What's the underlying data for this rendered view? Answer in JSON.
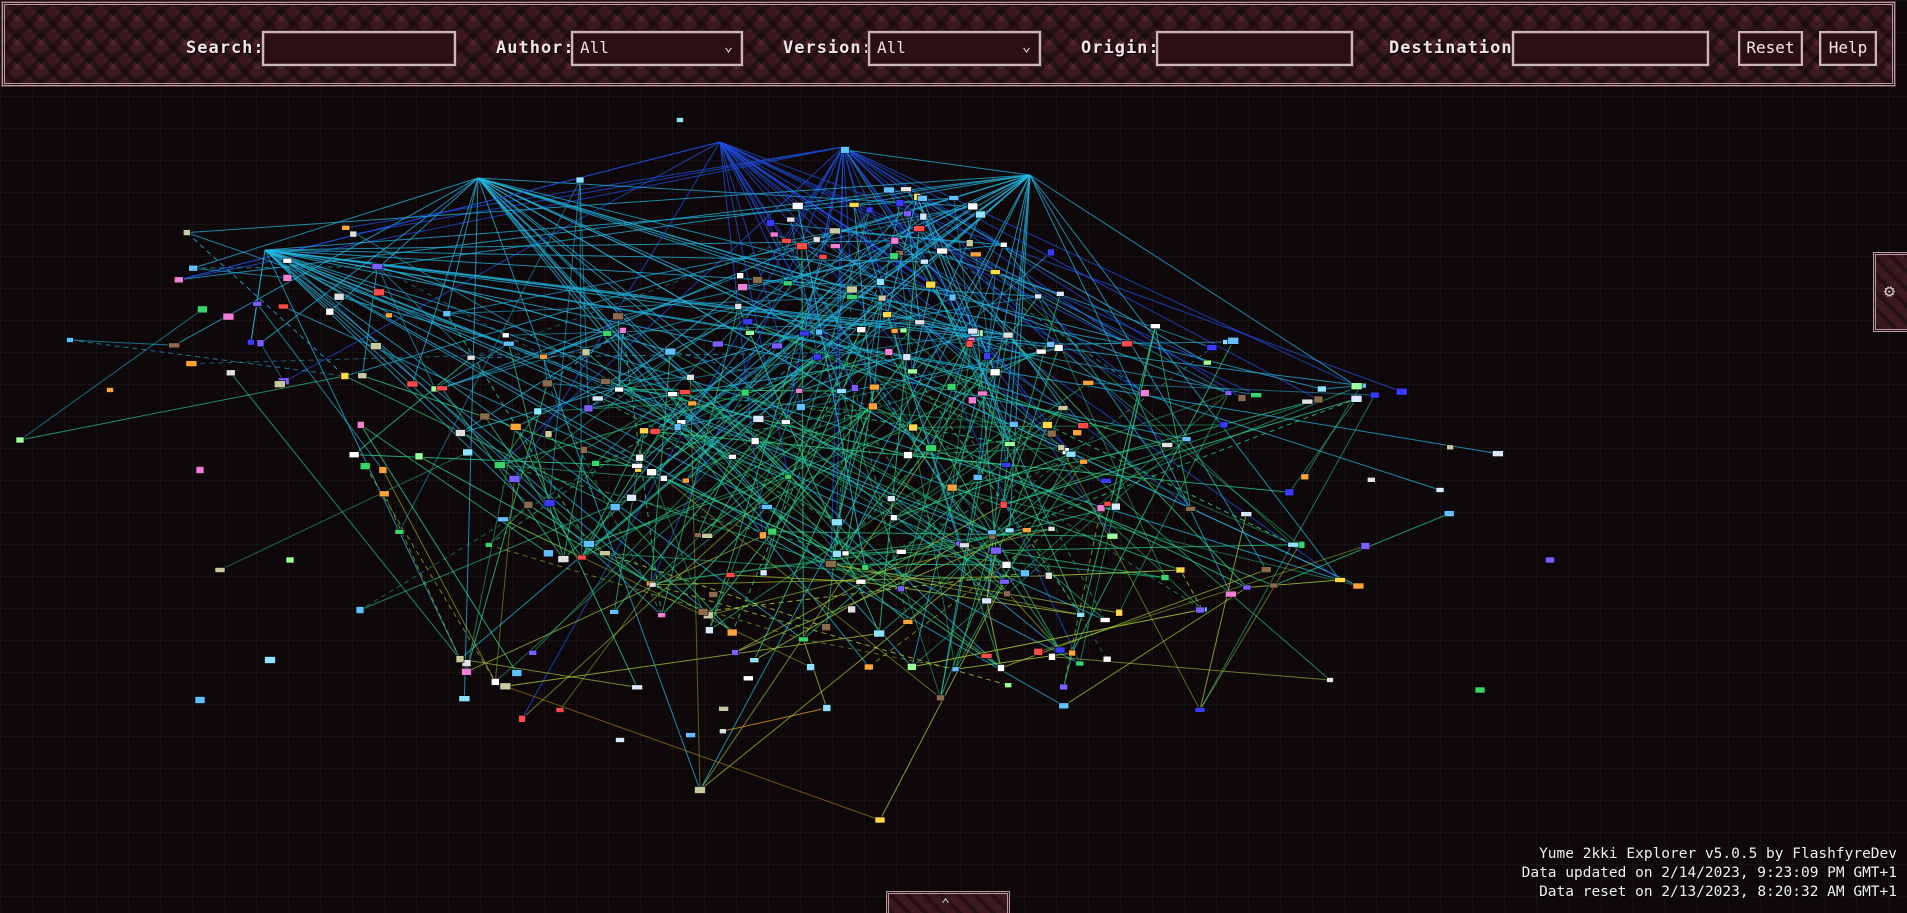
{
  "header": {
    "search_label": "Search:",
    "search_value": "",
    "author_label": "Author:",
    "author_selected": "All",
    "version_label": "Version:",
    "version_selected": "All",
    "origin_label": "Origin:",
    "origin_value": "",
    "destination_label": "Destination:",
    "destination_value": "",
    "reset_label": "Reset",
    "help_label": "Help"
  },
  "side_tab": {
    "icon": "settings-icon"
  },
  "bottom_tab": {
    "icon": "chevron-up-icon"
  },
  "info": {
    "app_line": "Yume 2kki Explorer v5.0.5 by FlashfyreDev",
    "updated_line": "Data updated on 2/14/2023, 9:23:09 PM GMT+1",
    "reset_line": "Data reset on 2/13/2023, 8:20:32 AM GMT+1"
  },
  "graph": {
    "type": "force-directed world map",
    "palette": {
      "background": "#0e080a",
      "edge_top": "#1f4fe0",
      "edge_upper": "#22b7e0",
      "edge_mid": "#2ad18a",
      "edge_low": "#a8cf3a",
      "edge_bottom": "#e0a020"
    }
  }
}
